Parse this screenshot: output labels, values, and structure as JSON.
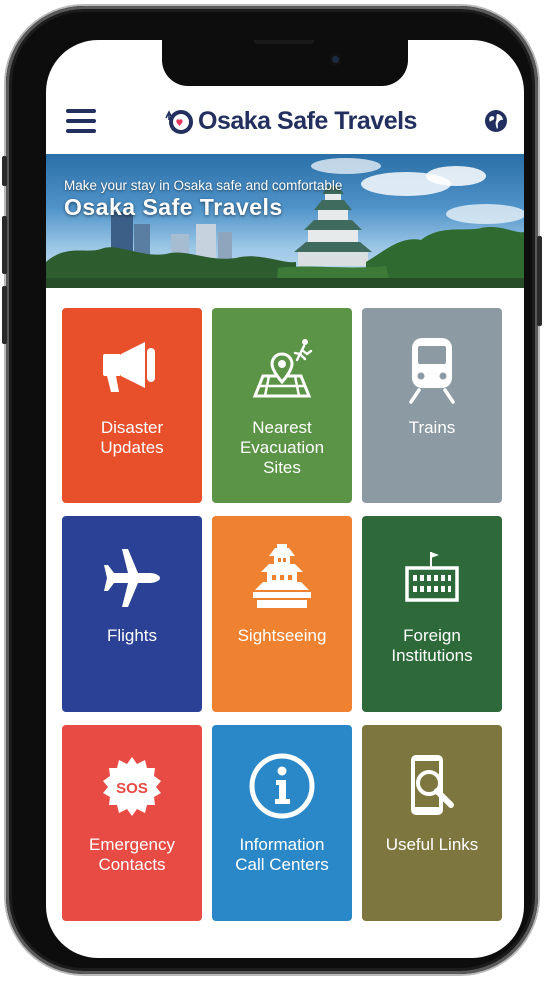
{
  "header": {
    "app_name": "Osaka Safe Travels",
    "menu_icon": "hamburger-menu-icon",
    "language_icon": "globe-icon",
    "brand_color": "#23305f"
  },
  "banner": {
    "tagline": "Make your stay in Osaka safe and comfortable",
    "title": "Osaka Safe Travels"
  },
  "tiles": [
    {
      "label": "Disaster\nUpdates",
      "icon": "megaphone-icon",
      "color": "#e8502b"
    },
    {
      "label": "Nearest\nEvacuation\nSites",
      "icon": "evacuation-map-icon",
      "color": "#5b9447"
    },
    {
      "label": "Trains",
      "icon": "train-icon",
      "color": "#8b9aa3"
    },
    {
      "label": "Flights",
      "icon": "airplane-icon",
      "color": "#2b4196"
    },
    {
      "label": "Sightseeing",
      "icon": "castle-icon",
      "color": "#ef8230"
    },
    {
      "label": "Foreign\nInstitutions",
      "icon": "embassy-icon",
      "color": "#2e6a39"
    },
    {
      "label": "Emergency\nContacts",
      "icon": "sos-icon",
      "color": "#e84b43"
    },
    {
      "label": "Information\nCall Centers",
      "icon": "info-icon",
      "color": "#2a88c8"
    },
    {
      "label": "Useful Links",
      "icon": "phone-search-icon",
      "color": "#7d763e"
    }
  ]
}
